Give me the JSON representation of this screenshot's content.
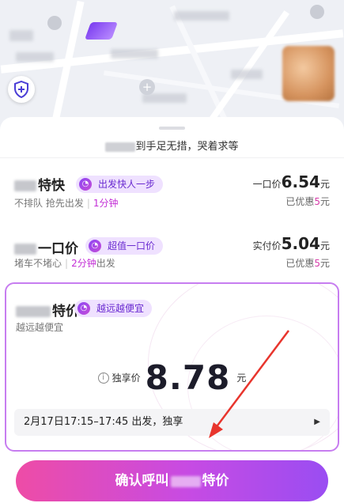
{
  "map": {
    "shield_icon": "shield-plus-icon"
  },
  "sheet": {
    "tip_text": "到手足无措，哭着求等"
  },
  "options": [
    {
      "title": "特快",
      "tag": "出发快人一步",
      "sub_a": "不排队 抢先出发",
      "sub_b": "1分钟",
      "price_label": "一口价",
      "price": "6.54",
      "price_unit": "元",
      "discount_label": "已优惠",
      "discount": "5",
      "discount_unit": "元"
    },
    {
      "title": "一口价",
      "tag": "超值一口价",
      "sub_a": "堵车不堵心",
      "sub_b": "2分钟",
      "sub_c": "出发",
      "price_label": "实付价",
      "price": "5.04",
      "price_unit": "元",
      "discount_label": "已优惠",
      "discount": "5",
      "discount_unit": "元"
    }
  ],
  "selected": {
    "title": "特价",
    "tag": "越远越便宜",
    "sub": "越远越便宜",
    "price_label": "独享价",
    "price": "8.78",
    "price_unit": "元",
    "time_text": "2月17日17:15–17:45 出发，独享"
  },
  "confirm": {
    "label_prefix": "确认呼叫",
    "label_suffix": "特价"
  },
  "colors": {
    "accent": "#c74be3",
    "tag_bg": "#efe1ff",
    "annotation": "#e8352d"
  }
}
